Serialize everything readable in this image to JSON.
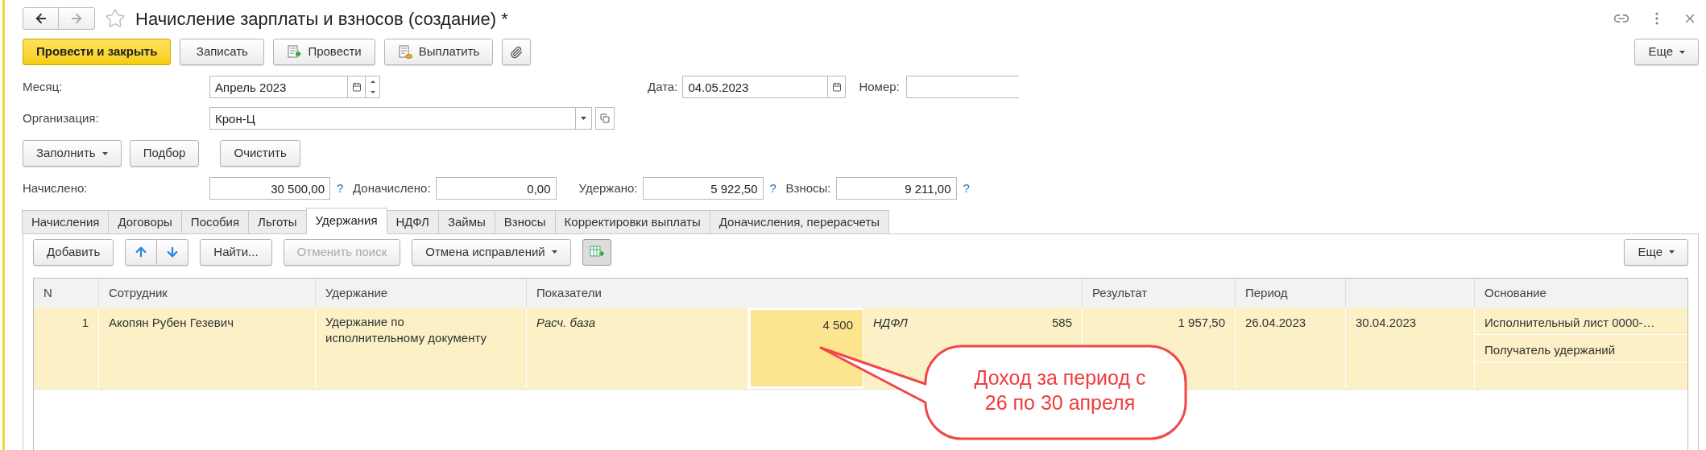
{
  "title": "Начисление зарплаты и взносов (создание) *",
  "toolbar": [
    {
      "kind": "primary",
      "label": "Провести и закрыть"
    },
    {
      "kind": "plain",
      "label": "Записать"
    },
    {
      "kind": "post",
      "label": "Провести"
    },
    {
      "kind": "pay",
      "label": "Выплатить"
    },
    {
      "kind": "attach"
    }
  ],
  "more_button": "Еще",
  "month": {
    "label": "Месяц:",
    "value": "Апрель 2023"
  },
  "date": {
    "label": "Дата:",
    "value": "04.05.2023"
  },
  "number": {
    "label": "Номер:"
  },
  "organization": {
    "label": "Организация:",
    "value": "Крон-Ц"
  },
  "fill_buttons": [
    {
      "label": "Заполнить",
      "dropdown": true
    },
    {
      "label": "Подбор",
      "dropdown": false
    },
    {
      "label": "Очистить",
      "dropdown": false
    }
  ],
  "totals": [
    {
      "label": "Начислено:",
      "value": "30 500,00",
      "hint": "?"
    },
    {
      "label": "Доначислено:",
      "value": "0,00"
    },
    {
      "label": "Удержано:",
      "value": "5 922,50",
      "hint": "?"
    },
    {
      "label": "Взносы:",
      "value": "9 211,00",
      "hint": "?"
    }
  ],
  "tabs": [
    {
      "label": "Начисления",
      "selected": false
    },
    {
      "label": "Договоры",
      "selected": false
    },
    {
      "label": "Пособия",
      "selected": false
    },
    {
      "label": "Льготы",
      "selected": false
    },
    {
      "label": "Удержания",
      "selected": true
    },
    {
      "label": "НДФЛ",
      "selected": false
    },
    {
      "label": "Займы",
      "selected": false
    },
    {
      "label": "Взносы",
      "selected": false
    },
    {
      "label": "Корректировки выплаты",
      "selected": false
    },
    {
      "label": "Доначисления, перерасчеты",
      "selected": false
    }
  ],
  "table_toolbar": [
    {
      "kind": "text",
      "label": "Добавить",
      "disabled": false
    },
    {
      "kind": "arrows"
    },
    {
      "kind": "text",
      "label": "Найти...",
      "disabled": false
    },
    {
      "kind": "text",
      "label": "Отменить поиск",
      "disabled": true
    },
    {
      "kind": "dropdown",
      "label": "Отмена исправлений",
      "disabled": false
    },
    {
      "kind": "table_add"
    }
  ],
  "table_more_button": "Еще",
  "table": {
    "columns": [
      "N",
      "Сотрудник",
      "Удержание",
      "Показатели",
      "Результат",
      "Период",
      "Основание"
    ],
    "rows": [
      {
        "n": "1",
        "employee": "Акопян Рубен Гезевич",
        "deduction": "Удержание по исполнительному документу",
        "indicators": [
          {
            "name": "Расч. база",
            "value": "4 500",
            "selected": true
          },
          {
            "name": "НДФЛ",
            "value": "585",
            "selected": false
          }
        ],
        "result": "1 957,50",
        "period_start": "26.04.2023",
        "period_end": "30.04.2023",
        "basis": [
          "Исполнительный лист 0000-…",
          "Получатель удержаний"
        ]
      }
    ]
  },
  "callout": [
    "Доход за период с",
    "26 по 30 апреля"
  ]
}
